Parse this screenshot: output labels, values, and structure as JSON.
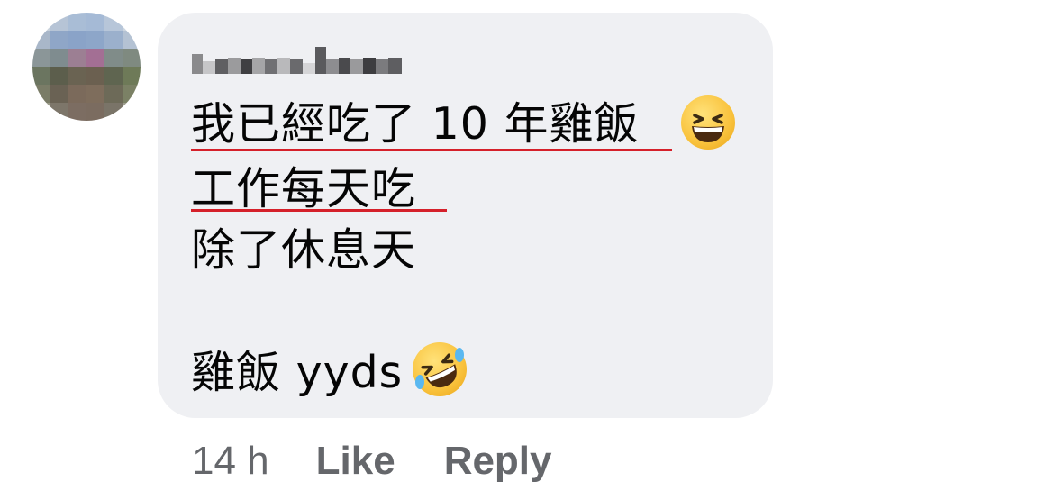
{
  "comment": {
    "author_name": "",
    "lines": [
      "我已經吃了 10 年雞飯",
      "工作每天吃",
      "除了休息天",
      "",
      "雞飯 yyds"
    ],
    "emojis": [
      "grinning-squinting-face-icon",
      "rolling-on-floor-laughing-icon"
    ]
  },
  "actions": {
    "time": "14 h",
    "like_label": "Like",
    "reply_label": "Reply"
  },
  "colors": {
    "bubble": "#eff0f3",
    "text": "#050505",
    "meta": "#65676b",
    "underline": "#d5202a"
  }
}
